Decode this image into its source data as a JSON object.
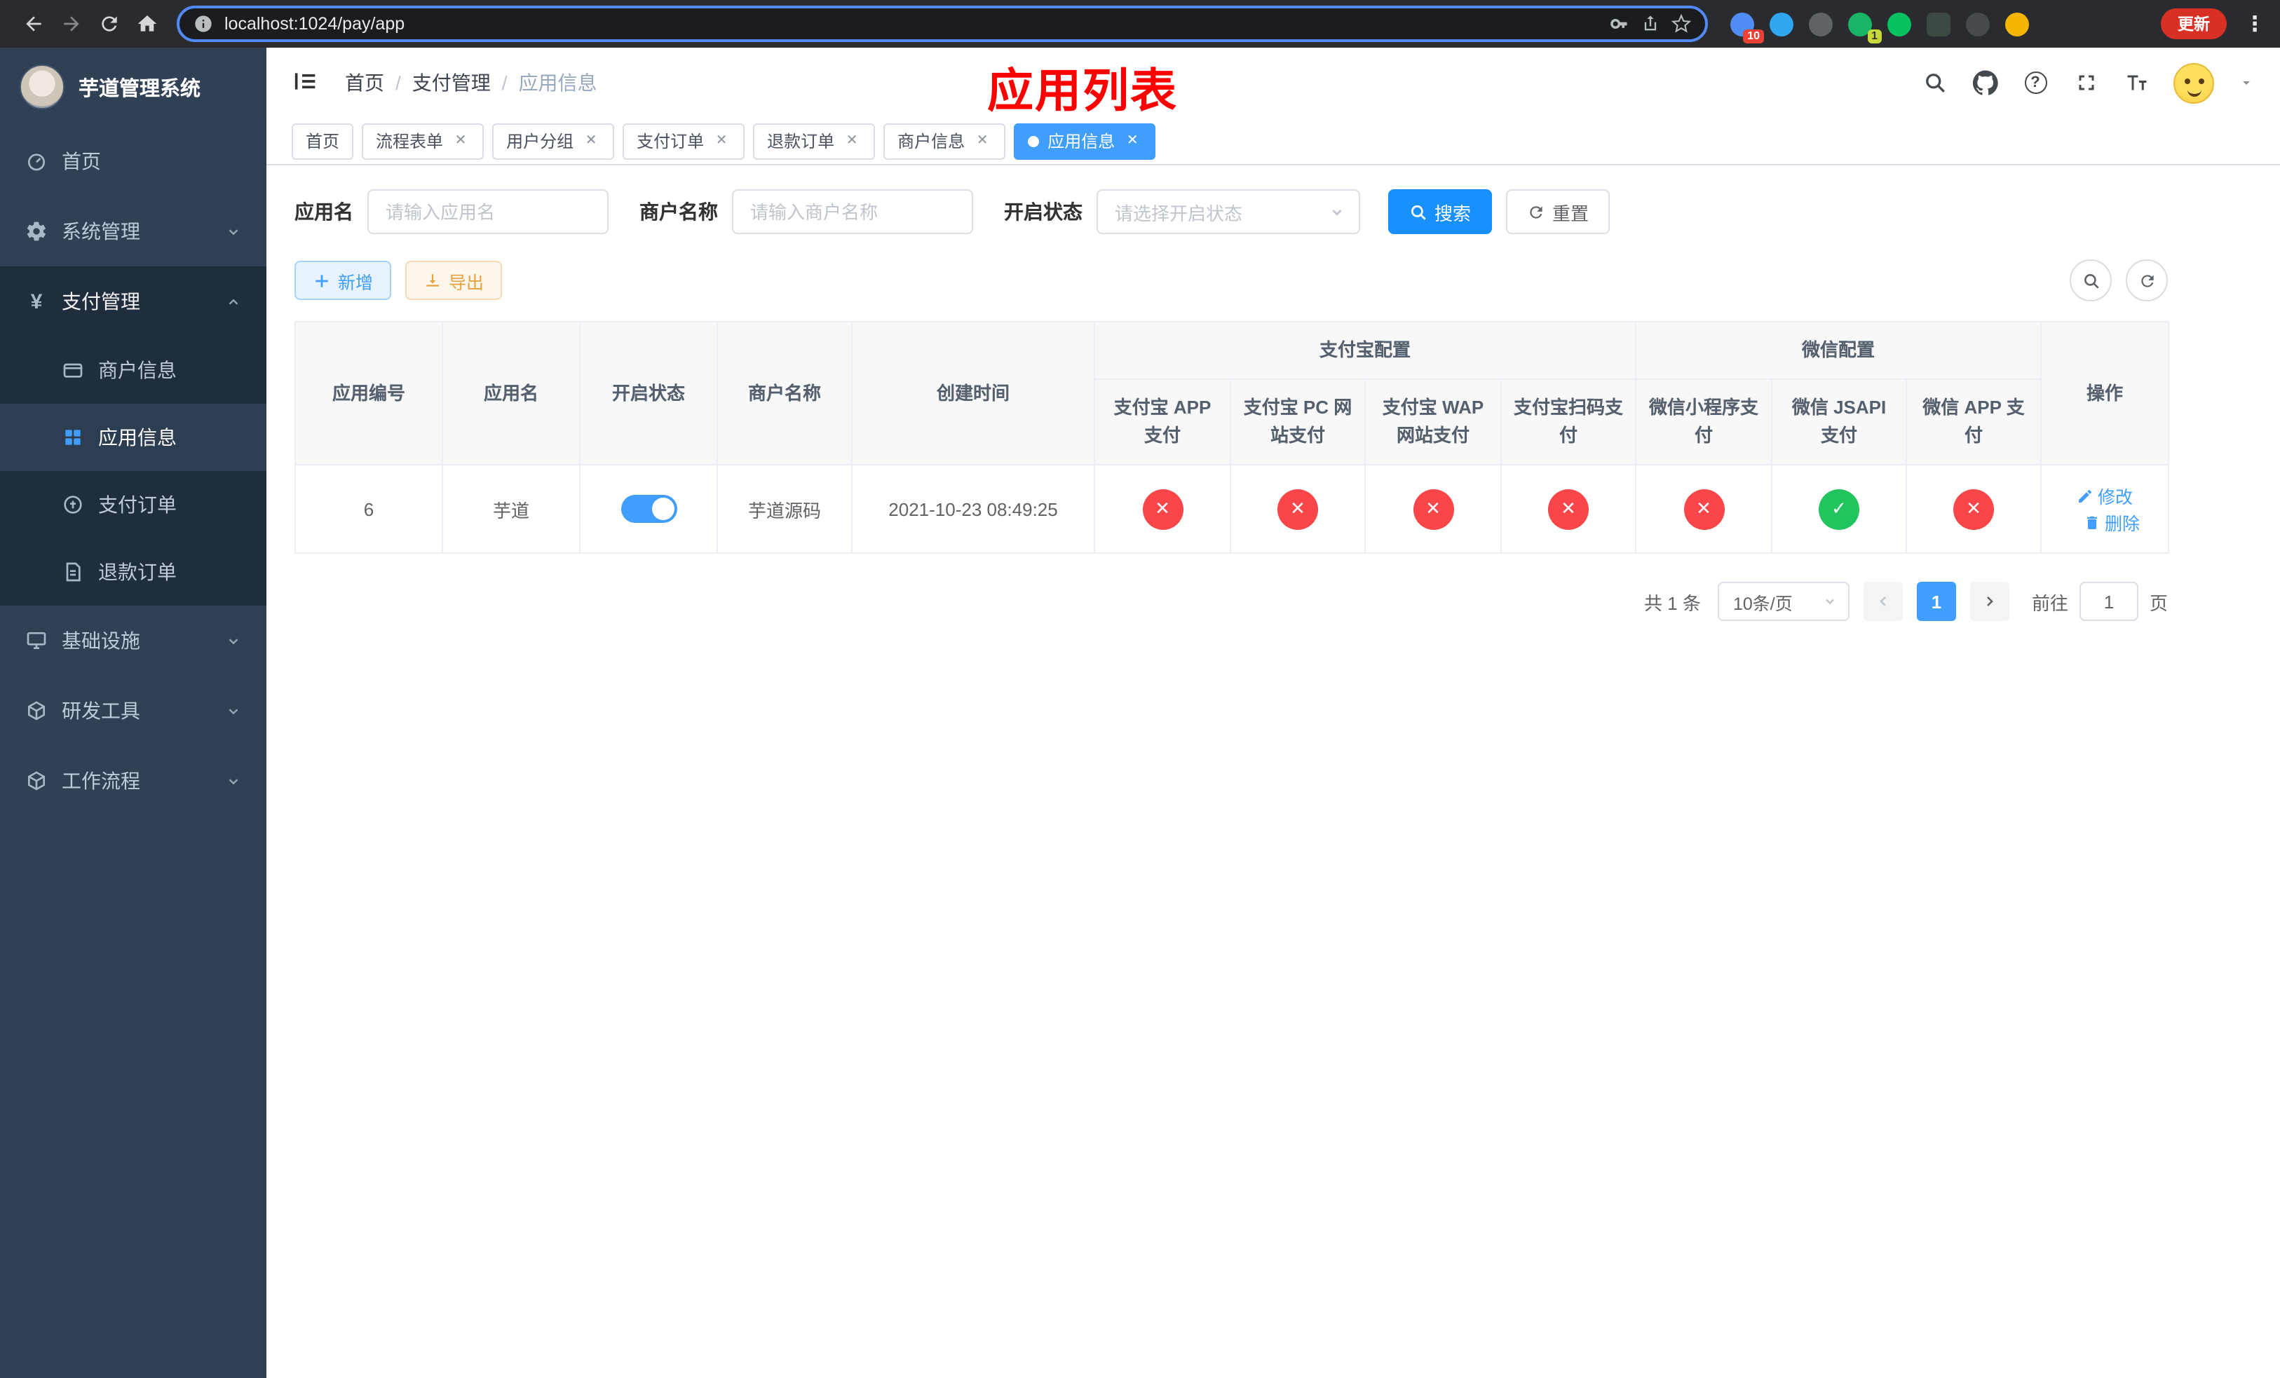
{
  "colors": {
    "accent": "#409eff",
    "search_button": "#1890ff",
    "danger": "#fa4549",
    "success": "#21c45d",
    "warning": "#e6a23c",
    "annotation": "#fe0000",
    "sidebar_bg": "#304156",
    "submenu_bg": "#1f2d3d"
  },
  "icons": {
    "close": "✕",
    "menu_dots": "⋮",
    "yen": "¥",
    "question": "?"
  },
  "browser": {
    "url": "localhost:1024/pay/app",
    "update_label": "更新",
    "extension_badge_1": "10",
    "extension_badge_2": "1"
  },
  "annotation": {
    "text": "应用列表"
  },
  "sidebar": {
    "logo_title": "芋道管理系统",
    "items": [
      {
        "label": "首页"
      },
      {
        "label": "系统管理"
      },
      {
        "label": "支付管理",
        "children": [
          {
            "label": "商户信息"
          },
          {
            "label": "应用信息"
          },
          {
            "label": "支付订单"
          },
          {
            "label": "退款订单"
          }
        ]
      },
      {
        "label": "基础设施"
      },
      {
        "label": "研发工具"
      },
      {
        "label": "工作流程"
      }
    ]
  },
  "header": {
    "breadcrumb": [
      "首页",
      "支付管理",
      "应用信息"
    ],
    "separator": "/"
  },
  "tabs": [
    {
      "label": "首页"
    },
    {
      "label": "流程表单"
    },
    {
      "label": "用户分组"
    },
    {
      "label": "支付订单"
    },
    {
      "label": "退款订单"
    },
    {
      "label": "商户信息"
    },
    {
      "label": "应用信息"
    }
  ],
  "filters": {
    "app_name_label": "应用名",
    "app_name_placeholder": "请输入应用名",
    "merchant_label": "商户名称",
    "merchant_placeholder": "请输入商户名称",
    "status_label": "开启状态",
    "status_placeholder": "请选择开启状态",
    "search_label": "搜索",
    "reset_label": "重置"
  },
  "toolbar": {
    "add_label": "新增",
    "export_label": "导出"
  },
  "table": {
    "headers": {
      "app_id": "应用编号",
      "app_name": "应用名",
      "status": "开启状态",
      "merchant": "商户名称",
      "created": "创建时间",
      "alipay_group": "支付宝配置",
      "wechat_group": "微信配置",
      "actions": "操作",
      "sub": [
        "支付宝 APP 支付",
        "支付宝 PC 网站支付",
        "支付宝 WAP 网站支付",
        "支付宝扫码支付",
        "微信小程序支付",
        "微信 JSAPI 支付",
        "微信 APP 支付"
      ]
    },
    "rows": [
      {
        "app_id": "6",
        "app_name": "芋道",
        "status": "on",
        "merchant": "芋道源码",
        "created": "2021-10-23 08:49:25",
        "flags": [
          "no",
          "no",
          "no",
          "no",
          "no",
          "yes",
          "no"
        ],
        "edit_label": "修改",
        "delete_label": "删除"
      }
    ]
  },
  "pagination": {
    "total_label": "共 1 条",
    "page_size": "10条/页",
    "current_page": "1",
    "goto_label": "前往",
    "page_unit": "页",
    "goto_value": "1"
  }
}
